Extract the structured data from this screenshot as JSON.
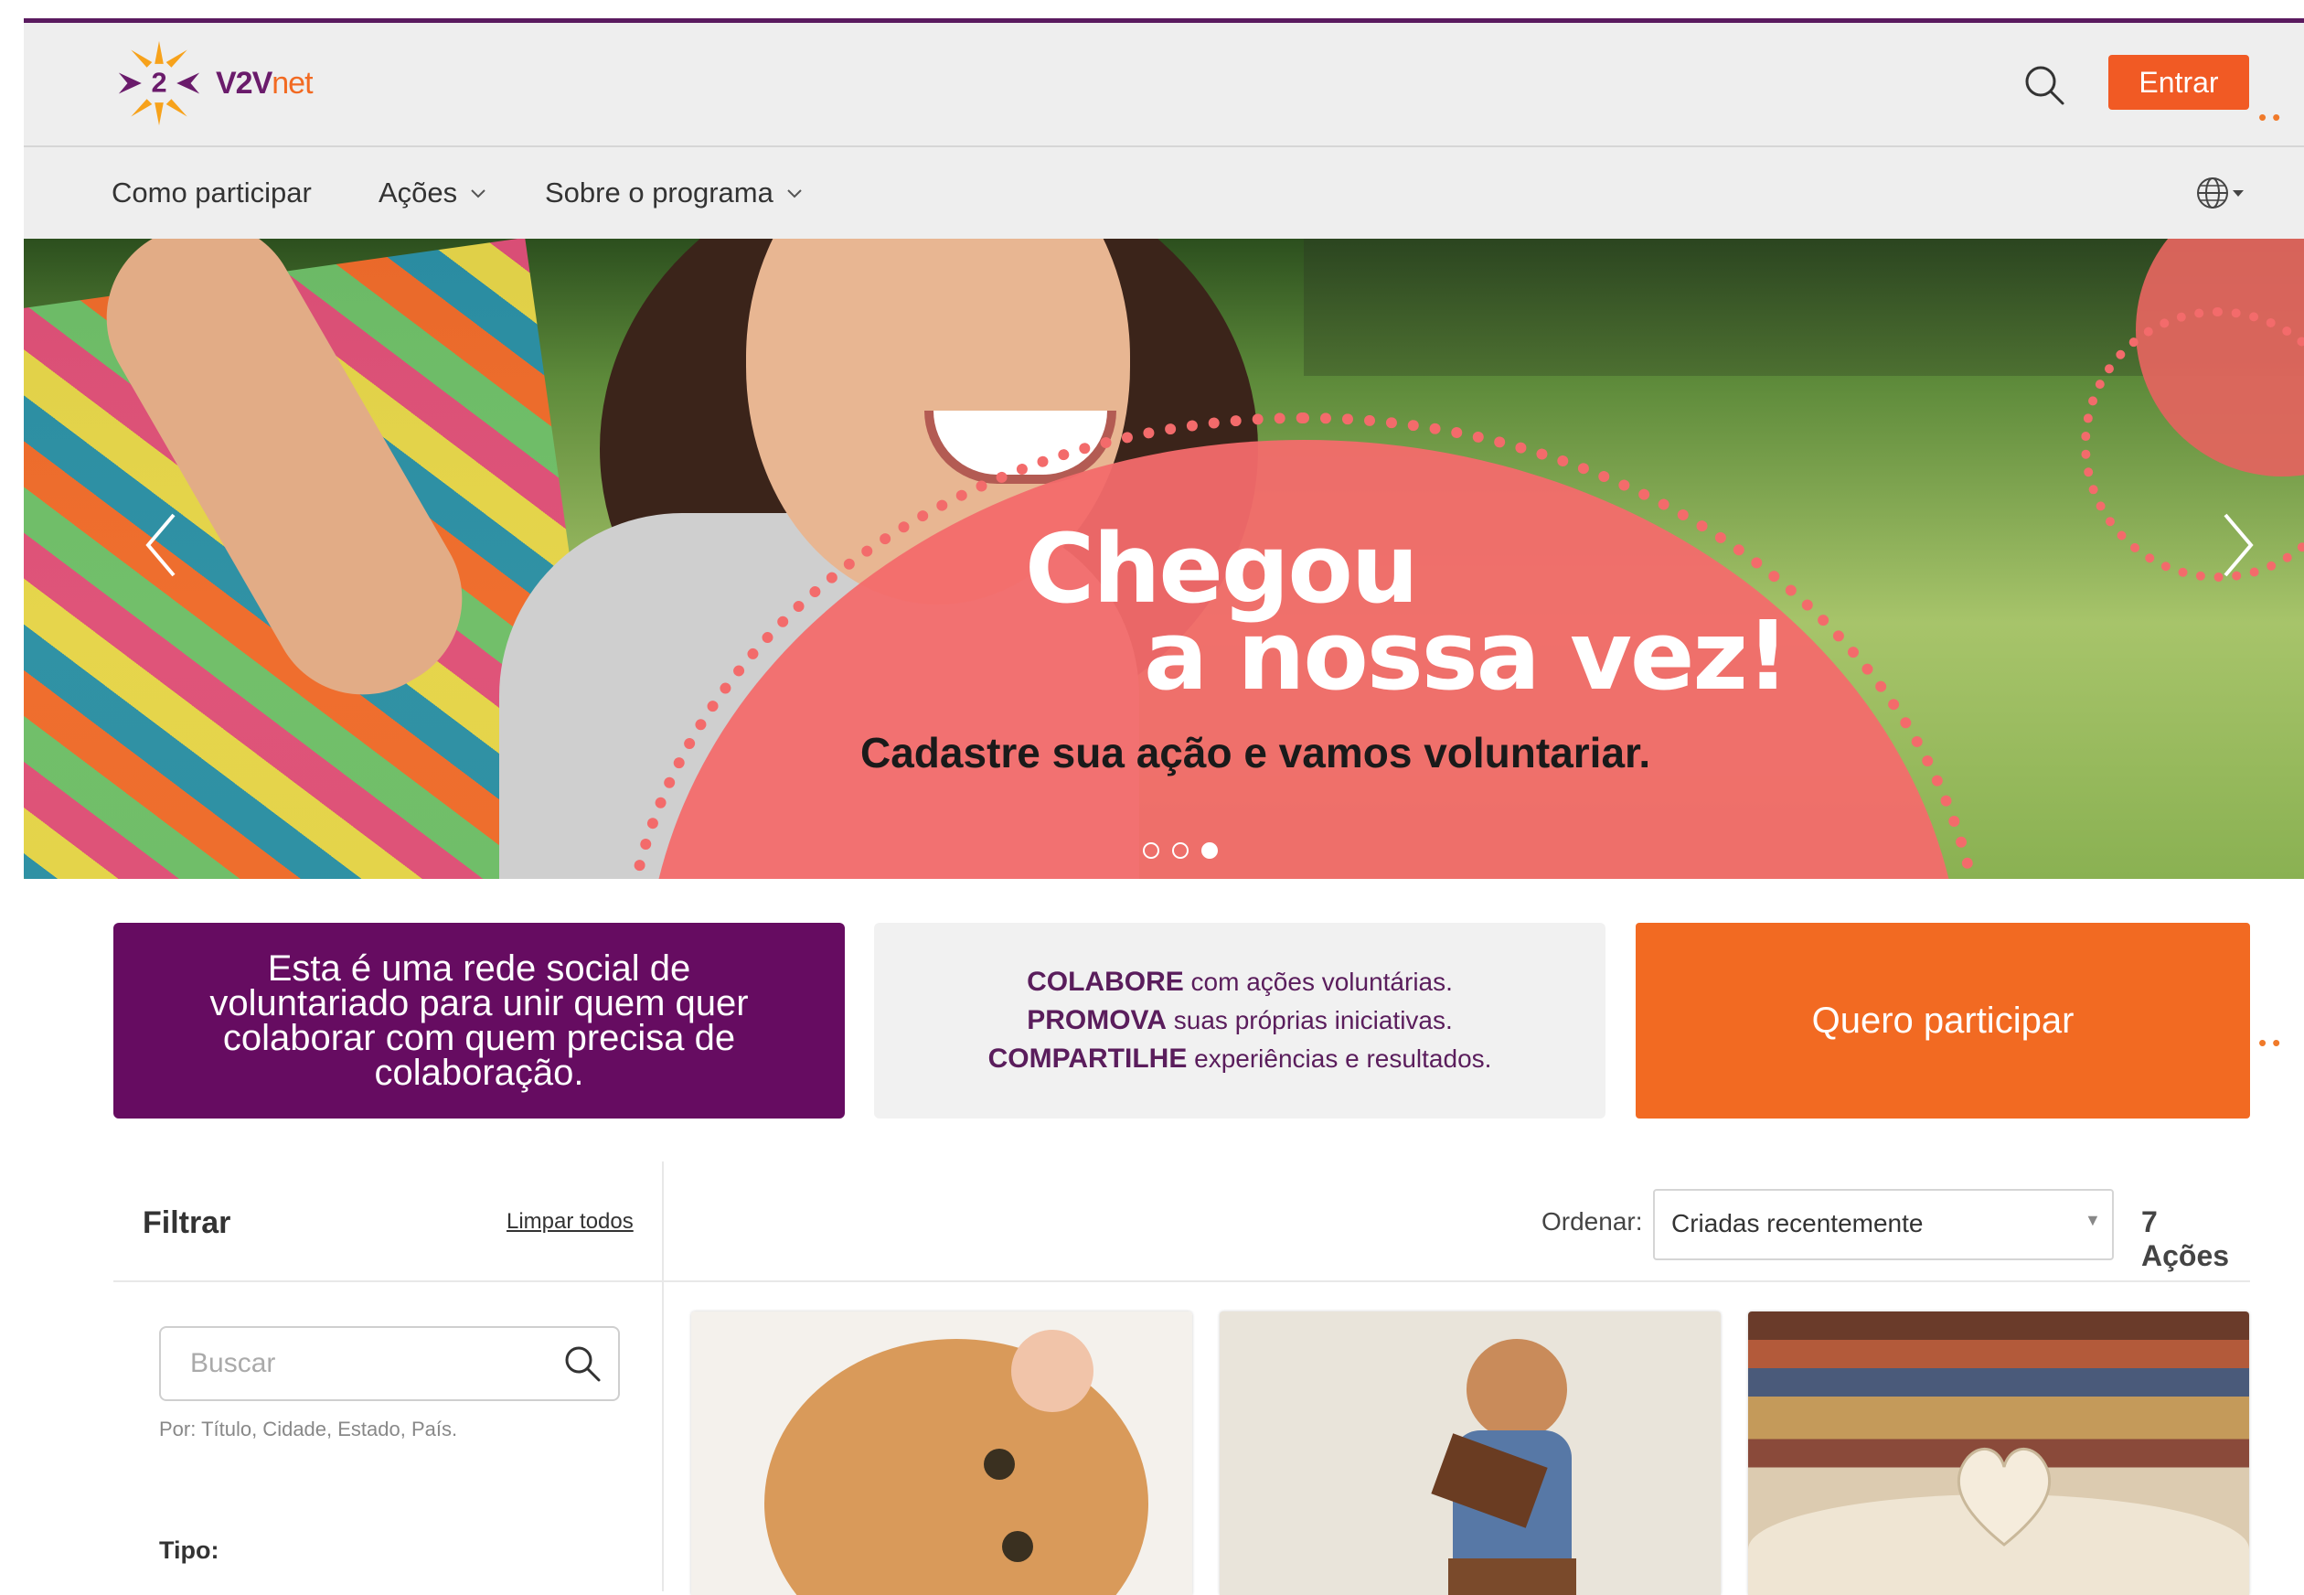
{
  "header": {
    "brand_main": "V2V",
    "brand_suffix": "net",
    "login_label": "Entrar"
  },
  "nav": {
    "items": [
      {
        "label": "Como participar"
      },
      {
        "label": "Ações"
      },
      {
        "label": "Sobre o programa"
      }
    ]
  },
  "hero": {
    "title_line1": "Chegou",
    "title_line2": "a nossa vez!",
    "subtitle": "Cadastre sua ação e vamos voluntariar.",
    "slides": 3,
    "active_slide": 3
  },
  "cards": {
    "intro_text": "Esta é uma rede social de voluntariado para unir quem quer colaborar com quem precisa de colaboração.",
    "lines": [
      {
        "bold": "COLABORE",
        "rest": " com ações voluntárias."
      },
      {
        "bold": "PROMOVA",
        "rest": " suas próprias iniciativas."
      },
      {
        "bold": "COMPARTILHE",
        "rest": " experiências e resultados."
      }
    ],
    "cta_label": "Quero participar"
  },
  "filter": {
    "title": "Filtrar",
    "clear_label": "Limpar todos",
    "search_placeholder": "Buscar",
    "search_hint": "Por: Título, Cidade, Estado, País.",
    "tipo_label": "Tipo:"
  },
  "sort": {
    "label": "Ordenar:",
    "selected": "Criadas recentemente",
    "count": "7 Ações"
  },
  "results": [
    {
      "image": "kitten-photo"
    },
    {
      "image": "girl-reading-photo"
    },
    {
      "image": "book-heart-photo"
    }
  ],
  "colors": {
    "brand_purple": "#660c61",
    "brand_orange": "#f26a22",
    "hero_pink": "#f36b6b"
  }
}
